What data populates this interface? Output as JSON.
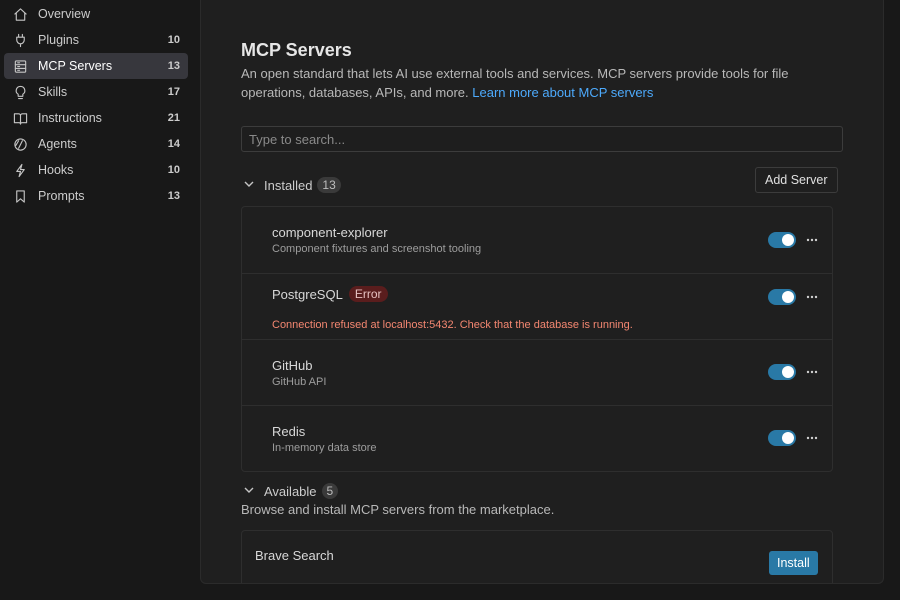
{
  "sidebar": {
    "items": [
      {
        "label": "Overview",
        "count": "",
        "icon": "home-icon"
      },
      {
        "label": "Plugins",
        "count": "10",
        "icon": "plug-icon"
      },
      {
        "label": "MCP Servers",
        "count": "13",
        "icon": "server-icon"
      },
      {
        "label": "Skills",
        "count": "17",
        "icon": "lightbulb-icon"
      },
      {
        "label": "Instructions",
        "count": "21",
        "icon": "book-icon"
      },
      {
        "label": "Agents",
        "count": "14",
        "icon": "agent-icon"
      },
      {
        "label": "Hooks",
        "count": "10",
        "icon": "lightning-icon"
      },
      {
        "label": "Prompts",
        "count": "13",
        "icon": "bookmark-icon"
      }
    ],
    "active": "MCP Servers"
  },
  "main": {
    "title": "MCP Servers",
    "description": "An open standard that lets AI use external tools and services. MCP servers provide tools for file operations, databases, APIs, and more.",
    "learn_more": "Learn more about MCP servers",
    "search_placeholder": "Type to search...",
    "add_server_label": "Add Server",
    "installed": {
      "label": "Installed",
      "count": "13",
      "servers": [
        {
          "name": "component-explorer",
          "description": "Component fixtures and screenshot tooling",
          "enabled": true
        },
        {
          "name": "PostgreSQL",
          "badge": "Error",
          "error": "Connection refused at localhost:5432. Check that the database is running.",
          "enabled": true
        },
        {
          "name": "GitHub",
          "description": "GitHub API",
          "enabled": true
        },
        {
          "name": "Redis",
          "description": "In-memory data store",
          "enabled": true
        }
      ]
    },
    "available": {
      "label": "Available",
      "count": "5",
      "description": "Browse and install MCP servers from the marketplace.",
      "servers": [
        {
          "name": "Brave Search",
          "action": "Install"
        }
      ]
    }
  },
  "colors": {
    "accent": "#2979a6",
    "link": "#4daafc",
    "error_text": "#f48771",
    "error_badge_bg": "#5a1d1d",
    "background": "#181818",
    "panel": "#1f1f1f"
  }
}
